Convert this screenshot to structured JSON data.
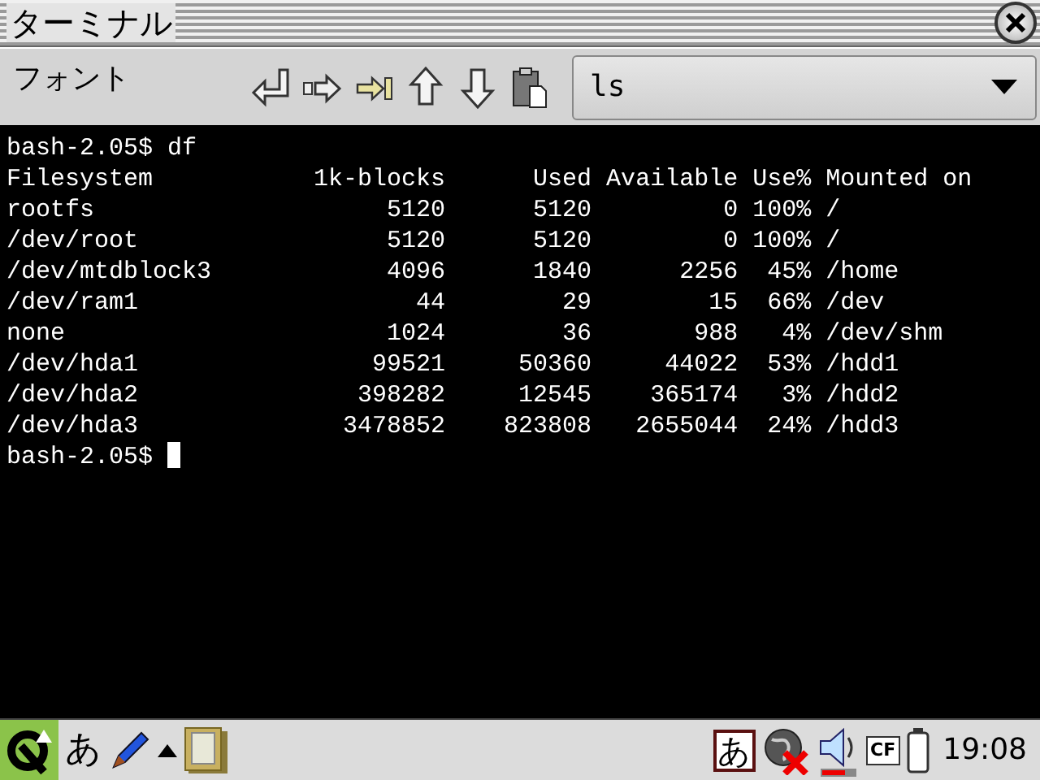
{
  "window": {
    "title": "ターミナル"
  },
  "toolbar": {
    "menu": "フォント",
    "command": {
      "value": "ls"
    }
  },
  "terminal": {
    "prompt_line": "bash-2.05$ df",
    "header": {
      "filesystem": "Filesystem",
      "blocks": "1k-blocks",
      "used": "Used",
      "available": "Available",
      "use_pct": "Use%",
      "mounted": "Mounted on"
    },
    "rows": [
      {
        "filesystem": "rootfs",
        "blocks": "5120",
        "used": "5120",
        "available": "0",
        "use_pct": "100%",
        "mounted": "/"
      },
      {
        "filesystem": "/dev/root",
        "blocks": "5120",
        "used": "5120",
        "available": "0",
        "use_pct": "100%",
        "mounted": "/"
      },
      {
        "filesystem": "/dev/mtdblock3",
        "blocks": "4096",
        "used": "1840",
        "available": "2256",
        "use_pct": "45%",
        "mounted": "/home"
      },
      {
        "filesystem": "/dev/ram1",
        "blocks": "44",
        "used": "29",
        "available": "15",
        "use_pct": "66%",
        "mounted": "/dev"
      },
      {
        "filesystem": "none",
        "blocks": "1024",
        "used": "36",
        "available": "988",
        "use_pct": "4%",
        "mounted": "/dev/shm"
      },
      {
        "filesystem": "/dev/hda1",
        "blocks": "99521",
        "used": "50360",
        "available": "44022",
        "use_pct": "53%",
        "mounted": "/hdd1"
      },
      {
        "filesystem": "/dev/hda2",
        "blocks": "398282",
        "used": "12545",
        "available": "365174",
        "use_pct": "3%",
        "mounted": "/hdd2"
      },
      {
        "filesystem": "/dev/hda3",
        "blocks": "3478852",
        "used": "823808",
        "available": "2655044",
        "use_pct": "24%",
        "mounted": "/hdd3"
      }
    ],
    "final_prompt": "bash-2.05$"
  },
  "taskbar": {
    "input_method": "あ",
    "tray_input_method": "あ",
    "cf_card": "CF",
    "clock": "19:08"
  }
}
